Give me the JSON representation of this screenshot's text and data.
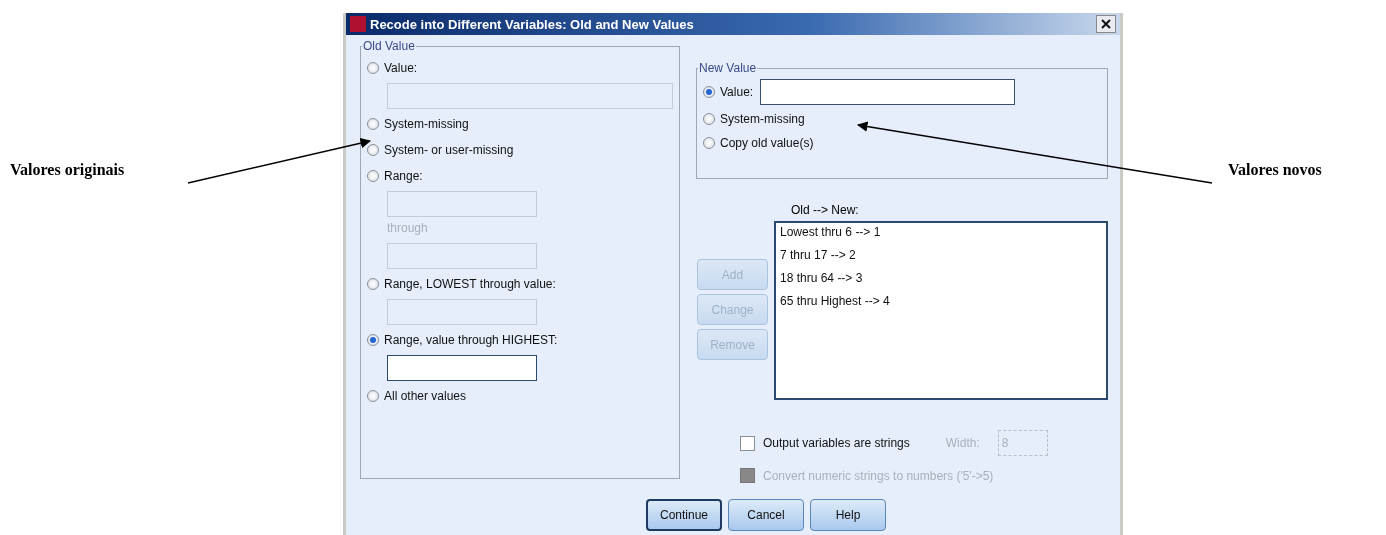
{
  "left_annotation": "Valores originais",
  "right_annotation": "Valores novos",
  "window": {
    "title": "Recode into Different Variables: Old and New Values"
  },
  "old_value": {
    "title": "Old Value",
    "items": [
      {
        "kind": "radio",
        "label": "Value:",
        "selected": false
      },
      {
        "kind": "field",
        "disabled": true
      },
      {
        "kind": "radio",
        "label": "System-missing",
        "selected": false
      },
      {
        "kind": "radio",
        "label": "System- or user-missing",
        "selected": false
      },
      {
        "kind": "radio",
        "label": "Range:",
        "selected": false
      },
      {
        "kind": "field",
        "disabled": true
      },
      {
        "kind": "label",
        "text": "through",
        "disabled": true
      },
      {
        "kind": "field",
        "disabled": true
      },
      {
        "kind": "radio",
        "label": "Range, LOWEST through value:",
        "selected": false
      },
      {
        "kind": "field",
        "disabled": true
      },
      {
        "kind": "radio",
        "label": "Range, value through HIGHEST:",
        "selected": true
      },
      {
        "kind": "field",
        "disabled": false
      },
      {
        "kind": "radio",
        "label": "All other values",
        "selected": false
      }
    ]
  },
  "new_value": {
    "title": "New Value",
    "items": [
      {
        "kind": "radio_field",
        "label": "Value:",
        "selected": true
      },
      {
        "kind": "radio",
        "label": "System-missing",
        "selected": false
      },
      {
        "kind": "radio",
        "label": "Copy old value(s)",
        "selected": false
      }
    ]
  },
  "mapping": {
    "label": "Old --> New:",
    "items": [
      "Lowest thru 6 --> 1",
      "7 thru 17 --> 2",
      "18 thru 64 --> 3",
      "65 thru Highest --> 4"
    ]
  },
  "side_buttons": [
    {
      "label": "Add",
      "disabled": true
    },
    {
      "label": "Change",
      "disabled": true
    },
    {
      "label": "Remove",
      "disabled": true
    }
  ],
  "options": [
    {
      "label": "Output variables are strings",
      "checked": false,
      "disabled": false
    },
    {
      "label": "Convert numeric strings to numbers ('5'->5)",
      "checked": false,
      "disabled": true
    }
  ],
  "width": {
    "label": "Width:",
    "value": "8",
    "disabled": true
  },
  "buttons": [
    {
      "label": "Continue",
      "default": true
    },
    {
      "label": "Cancel",
      "default": false
    },
    {
      "label": "Help",
      "default": false
    }
  ]
}
